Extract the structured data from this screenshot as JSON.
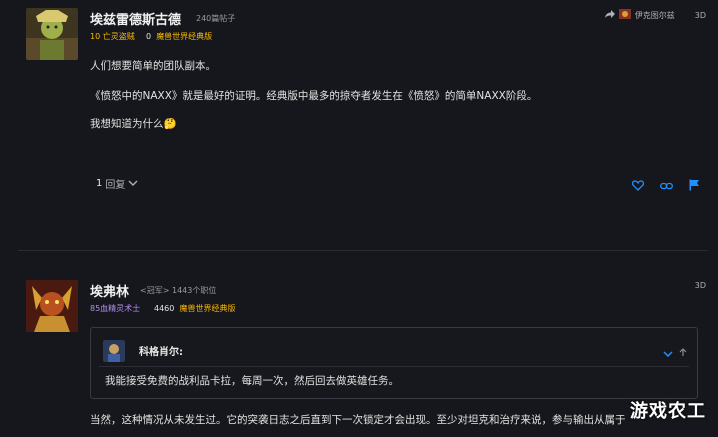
{
  "post1": {
    "author": "埃兹雷德斯古德",
    "post_count": "240篇帖子",
    "level": "10",
    "class": "亡灵盗贼",
    "achievements": "0",
    "realm": "魔兽世界经典版",
    "server_label": "伊克图尔兹",
    "time": "3D",
    "lines": [
      "人们想要简单的团队副本。",
      "《愤怒中的NAXX》就是最好的证明。经典版中最多的掠夺者发生在《愤怒》的简单NAXX阶段。",
      "我想知道为什么🤔"
    ],
    "reply_count": "1",
    "reply_label": "回复",
    "colors": {
      "accent": "#1e90ff",
      "gold": "#f8b700"
    }
  },
  "post2": {
    "author": "埃弗林",
    "title_badge": "<冠军>",
    "post_count": "1443个职位",
    "class_line": "85血精灵术士",
    "achievements": "4460",
    "realm": "魔兽世界经典版",
    "time": "3D",
    "quote": {
      "author": "科格肖尔:",
      "text": "我能接受免费的战利品卡拉，每周一次，然后回去做英雄任务。"
    },
    "body": "当然，这种情况从未发生过。它的突袭日志之后直到下一次锁定才会出现。至少对坦克和治疗来说，参与输出从属于"
  },
  "watermark": "游戏农工"
}
